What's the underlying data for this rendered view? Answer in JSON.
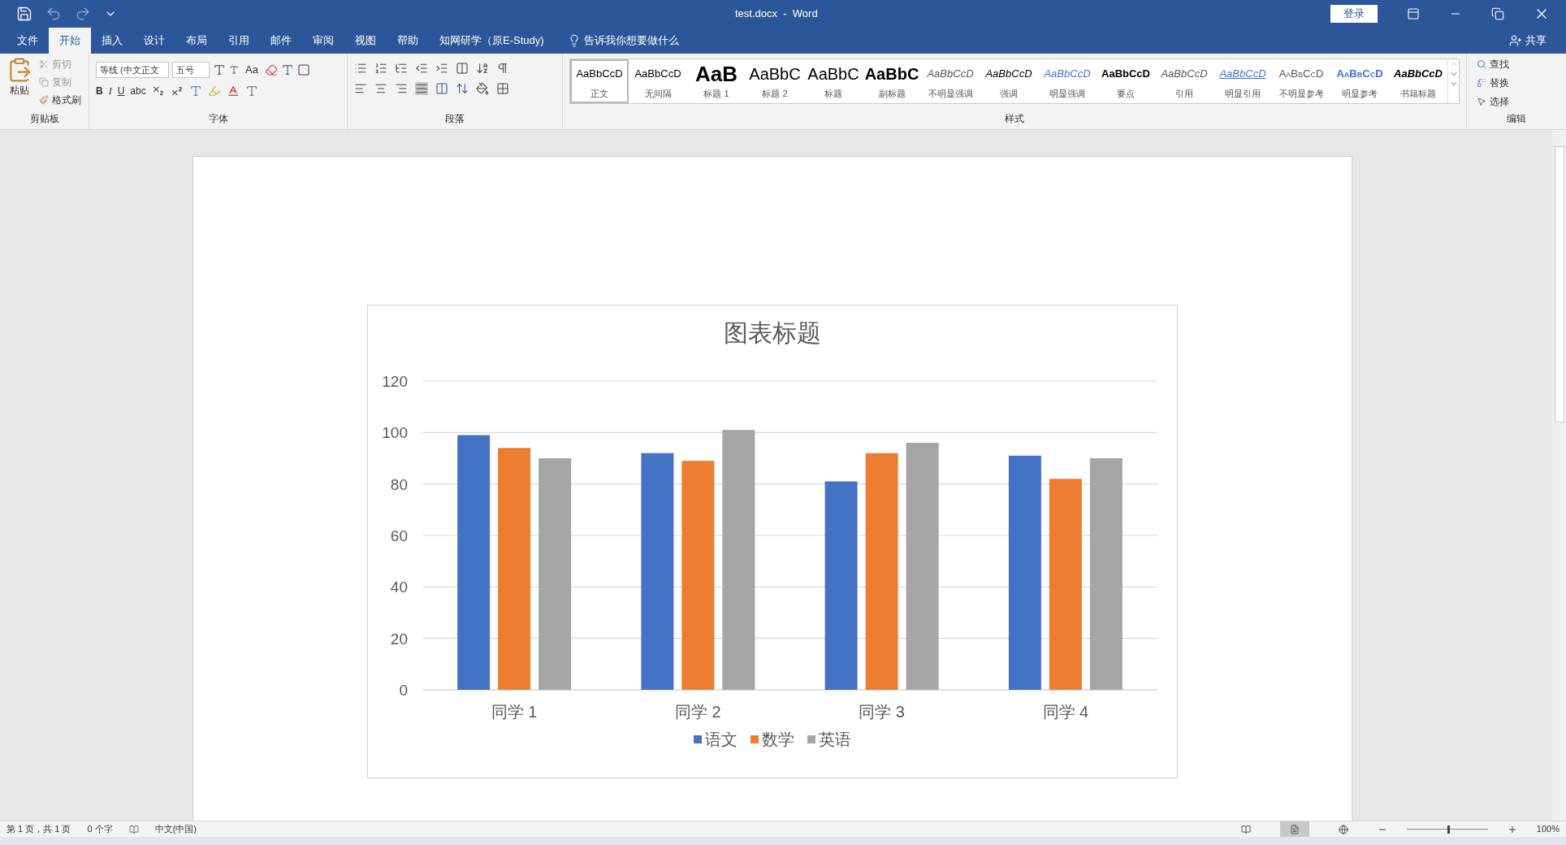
{
  "title_bar": {
    "title": "test.docx  -  Word",
    "login_button": "登录"
  },
  "tabs": [
    {
      "label": "文件",
      "selected": false
    },
    {
      "label": "开始",
      "selected": true
    },
    {
      "label": "插入",
      "selected": false
    },
    {
      "label": "设计",
      "selected": false
    },
    {
      "label": "布局",
      "selected": false
    },
    {
      "label": "引用",
      "selected": false
    },
    {
      "label": "邮件",
      "selected": false
    },
    {
      "label": "审阅",
      "selected": false
    },
    {
      "label": "视图",
      "selected": false
    },
    {
      "label": "帮助",
      "selected": false
    },
    {
      "label": "知网研学（原E-Study)",
      "selected": false
    }
  ],
  "tell_me": "告诉我你想要做什么",
  "share": "共享",
  "clipboard": {
    "paste": "粘贴",
    "cut": "剪切",
    "copy": "复制",
    "format_painter": "格式刷",
    "label": "剪贴板"
  },
  "font": {
    "font_name": "等线 (中文正文",
    "font_size": "五号",
    "case_button": "Aa",
    "format_buttons": [
      "B",
      "I",
      "U",
      "abc"
    ],
    "label": "字体"
  },
  "paragraph": {
    "label": "段落"
  },
  "styles": {
    "label": "样式",
    "items": [
      {
        "kind": "normal",
        "preview": "AaBbCcD",
        "name": "正文",
        "selected": true
      },
      {
        "kind": "normal",
        "preview": "AaBbCcD",
        "name": "无间隔",
        "selected": false
      },
      {
        "kind": "heading1",
        "preview": "AaB",
        "name": "标题 1",
        "selected": false
      },
      {
        "kind": "heading2",
        "preview": "AaBbC",
        "name": "标题 2",
        "selected": false
      },
      {
        "kind": "heading2",
        "preview": "AaBbC",
        "name": "标题",
        "selected": false
      },
      {
        "kind": "subtitle",
        "preview": "AaBbC",
        "name": "副标题",
        "selected": false
      },
      {
        "kind": "subtle",
        "preview": "AaBbCcD",
        "name": "不明显强调",
        "selected": false
      },
      {
        "kind": "emphasis",
        "preview": "AaBbCcD",
        "name": "强调",
        "selected": false
      },
      {
        "kind": "intense",
        "preview": "AaBbCcD",
        "name": "明显强调",
        "selected": false
      },
      {
        "kind": "strong",
        "preview": "AaBbCcD",
        "name": "要点",
        "selected": false
      },
      {
        "kind": "subtle",
        "preview": "AaBbCcD",
        "name": "引用",
        "selected": false
      },
      {
        "kind": "intense_quote",
        "preview": "AaBbCcD",
        "name": "明显引用",
        "selected": false
      },
      {
        "kind": "subtle_ref",
        "preview": "AaBbCcD",
        "name": "不明显参考",
        "selected": false
      },
      {
        "kind": "intense_ref",
        "preview": "AaBbCcD",
        "name": "明显参考",
        "selected": false
      },
      {
        "kind": "book",
        "preview": "AaBbCcD",
        "name": "书籍标题",
        "selected": false
      }
    ]
  },
  "editing": {
    "find": "查找",
    "replace": "替换",
    "select": "选择",
    "label": "编辑"
  },
  "chart": {
    "chart_data": {
      "type": "bar",
      "title": "图表标题",
      "categories": [
        "同学 1",
        "同学 2",
        "同学 3",
        "同学 4"
      ],
      "series": [
        {
          "name": "语文",
          "color": "#4472c4",
          "values": [
            99,
            92,
            81,
            91
          ]
        },
        {
          "name": "数学",
          "color": "#ed7d31",
          "values": [
            94,
            89,
            92,
            82
          ]
        },
        {
          "name": "英语",
          "color": "#a5a5a5",
          "values": [
            90,
            101,
            96,
            90
          ]
        }
      ],
      "ylim": [
        0,
        120
      ],
      "yticks": [
        0,
        20,
        40,
        60,
        80,
        100,
        120
      ],
      "grid": true,
      "legend": true
    }
  },
  "status_bar": {
    "page": "第 1 页，共 1 页",
    "words": "0 个字",
    "language": "中文(中国)",
    "views": [
      {
        "kind": "read",
        "selected": false
      },
      {
        "kind": "print",
        "selected": true
      },
      {
        "kind": "web",
        "selected": false
      }
    ],
    "zoom": "100%",
    "zoom_slider": {
      "level": 0.5
    }
  }
}
